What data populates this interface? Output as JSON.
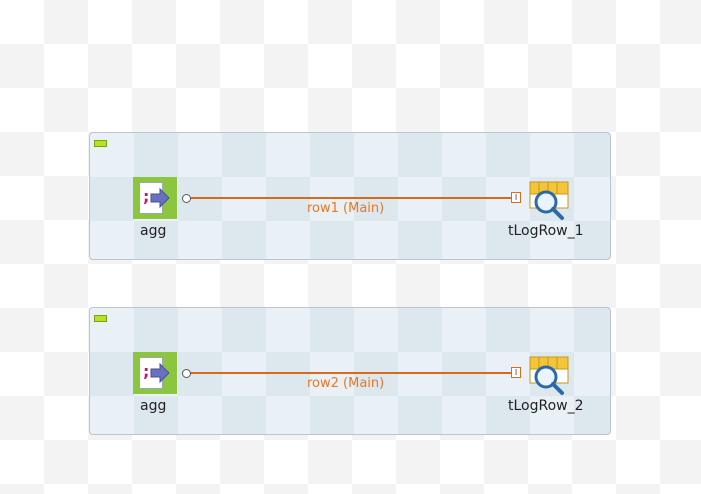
{
  "colors": {
    "connection": "#d66a1b",
    "connection_label": "#e87722",
    "subjob_bg": "#eaf1f6",
    "agg_icon_bg": "#8cc63f"
  },
  "subjobs": [
    {
      "source": {
        "label": "agg",
        "icon": "file-input-icon"
      },
      "connection": {
        "label": "row1 (Main)"
      },
      "target": {
        "label": "tLogRow_1",
        "icon": "log-row-icon"
      }
    },
    {
      "source": {
        "label": "agg",
        "icon": "file-input-icon"
      },
      "connection": {
        "label": "row2 (Main)"
      },
      "target": {
        "label": "tLogRow_2",
        "icon": "log-row-icon"
      }
    }
  ]
}
